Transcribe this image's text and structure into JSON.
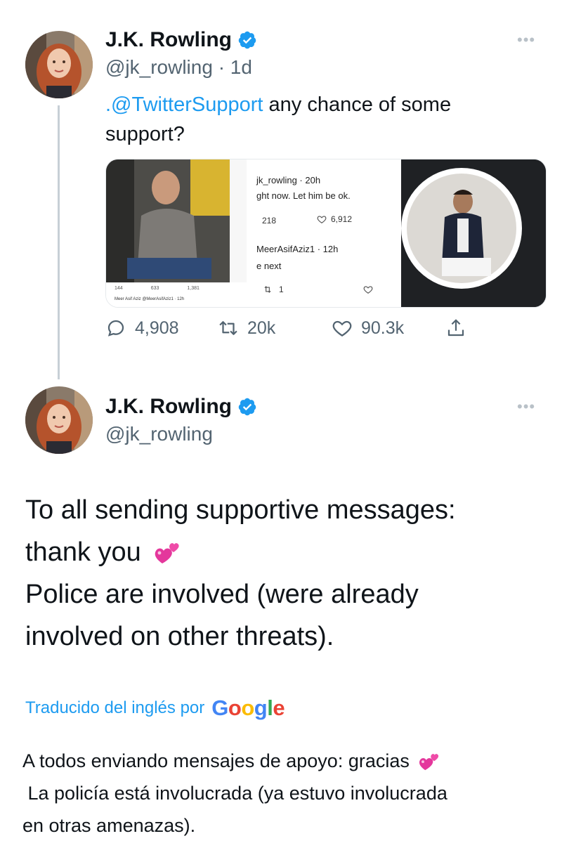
{
  "tweet1": {
    "display_name": "J.K. Rowling",
    "handle_time": "@jk_rowling · 1d",
    "more": "•••",
    "mention": ".@TwitterSupport",
    "text": " any chance of some support?",
    "embedded_screenshot": {
      "line1": "jk_rowling · 20h",
      "line2": "ght now. Let him be ok.",
      "retweets": "218",
      "likes": "6,912",
      "line3": "MeerAsifAziz1 · 12h",
      "line4": "e next",
      "retweets2": "1",
      "left_caption": "Meer Asif Aziz @MeerAsifAziz1 · 12h",
      "left_stats": [
        "144",
        "633",
        "1,381"
      ]
    },
    "actions": {
      "replies": "4,908",
      "retweets": "20k",
      "likes": "90.3k"
    }
  },
  "tweet2": {
    "display_name": "J.K. Rowling",
    "handle": "@jk_rowling",
    "more": "•••",
    "line1": "To all sending supportive messages:",
    "line2": "thank you",
    "line3": "Police are involved (were already",
    "line4": "involved on other threats)."
  },
  "translation": {
    "label": "Traducido del inglés por",
    "provider": "Google",
    "line1": "A todos enviando mensajes de apoyo: gracias",
    "line2": " La policía está involucrada (ya estuvo involucrada",
    "line3": "en otras amenazas)."
  },
  "colors": {
    "link": "#1d9bf0",
    "verified": "#1d9bf0",
    "secondary_text": "#536471"
  },
  "icons": [
    "verified-badge-icon",
    "more-icon",
    "reply-icon",
    "retweet-icon",
    "like-icon",
    "share-icon",
    "two-hearts-emoji"
  ]
}
